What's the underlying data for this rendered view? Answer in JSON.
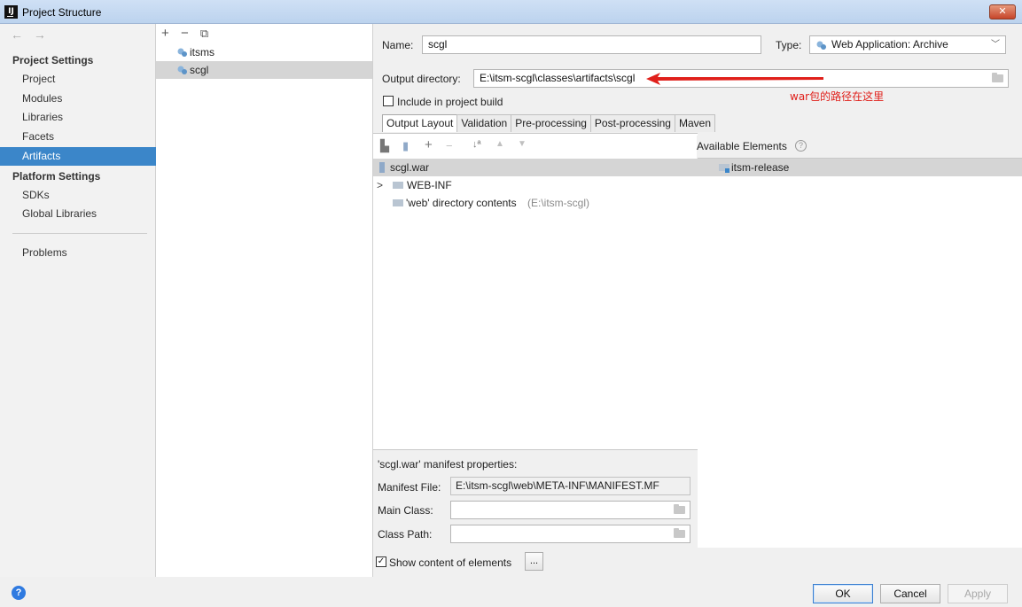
{
  "window": {
    "title": "Project Structure",
    "app_icon_text": "IJ",
    "close_glyph": "✕"
  },
  "sidebar": {
    "nav_arrows": "← →",
    "project_settings_header": "Project Settings",
    "project_items": [
      {
        "label": "Project"
      },
      {
        "label": "Modules"
      },
      {
        "label": "Libraries"
      },
      {
        "label": "Facets"
      },
      {
        "label": "Artifacts",
        "selected": true
      }
    ],
    "platform_settings_header": "Platform Settings",
    "platform_items": [
      {
        "label": "SDKs"
      },
      {
        "label": "Global Libraries"
      }
    ],
    "problems_label": "Problems"
  },
  "artifacts_list": {
    "toolbar": {
      "add": "+",
      "remove": "−",
      "copy": "⧉"
    },
    "items": [
      {
        "label": "itsms",
        "icon": "web-app-icon"
      },
      {
        "label": "scgl",
        "icon": "web-app-icon",
        "selected": true
      }
    ]
  },
  "details": {
    "name_label": "Name:",
    "name_value": "scgl",
    "type_label": "Type:",
    "type_value": "Web Application: Archive",
    "output_dir_label": "Output directory:",
    "output_dir_value": "E:\\itsm-scgl\\classes\\artifacts\\scgl",
    "include_build_label": "Include in project build",
    "include_build_checked": false,
    "annotation": "war包的路径在这里",
    "annotation_color": "#e0201b"
  },
  "tabs": [
    {
      "label": "Output Layout",
      "active": true
    },
    {
      "label": "Validation"
    },
    {
      "label": "Pre-processing"
    },
    {
      "label": "Post-processing"
    },
    {
      "label": "Maven"
    }
  ],
  "layout_tree": {
    "rows": [
      {
        "label": "scgl.war",
        "icon": "archive-icon",
        "selected": true
      },
      {
        "label": "WEB-INF",
        "icon": "folder-icon",
        "expandable": true
      },
      {
        "label": "'web' directory contents",
        "suffix": "(E:\\itsm-scgl)",
        "icon": "folder-icon"
      }
    ]
  },
  "available": {
    "header": "Available Elements",
    "help_glyph": "?",
    "items": [
      {
        "label": "itsm-release",
        "icon": "module-folder-icon",
        "selected": true
      }
    ]
  },
  "manifest": {
    "title": "'scgl.war' manifest properties:",
    "manifest_file_label": "Manifest File:",
    "manifest_file_value": "E:\\itsm-scgl\\web\\META-INF\\MANIFEST.MF",
    "main_class_label": "Main Class:",
    "main_class_value": "",
    "class_path_label": "Class Path:",
    "class_path_value": ""
  },
  "show_content": {
    "label": "Show content of elements",
    "checked": true,
    "button_label": "..."
  },
  "footer": {
    "help_glyph": "?",
    "ok_label": "OK",
    "cancel_label": "Cancel",
    "apply_label": "Apply"
  },
  "colors": {
    "selection": "#3b86c9",
    "annotation_red": "#e0201b",
    "accent_blue": "#2f7ae0"
  }
}
